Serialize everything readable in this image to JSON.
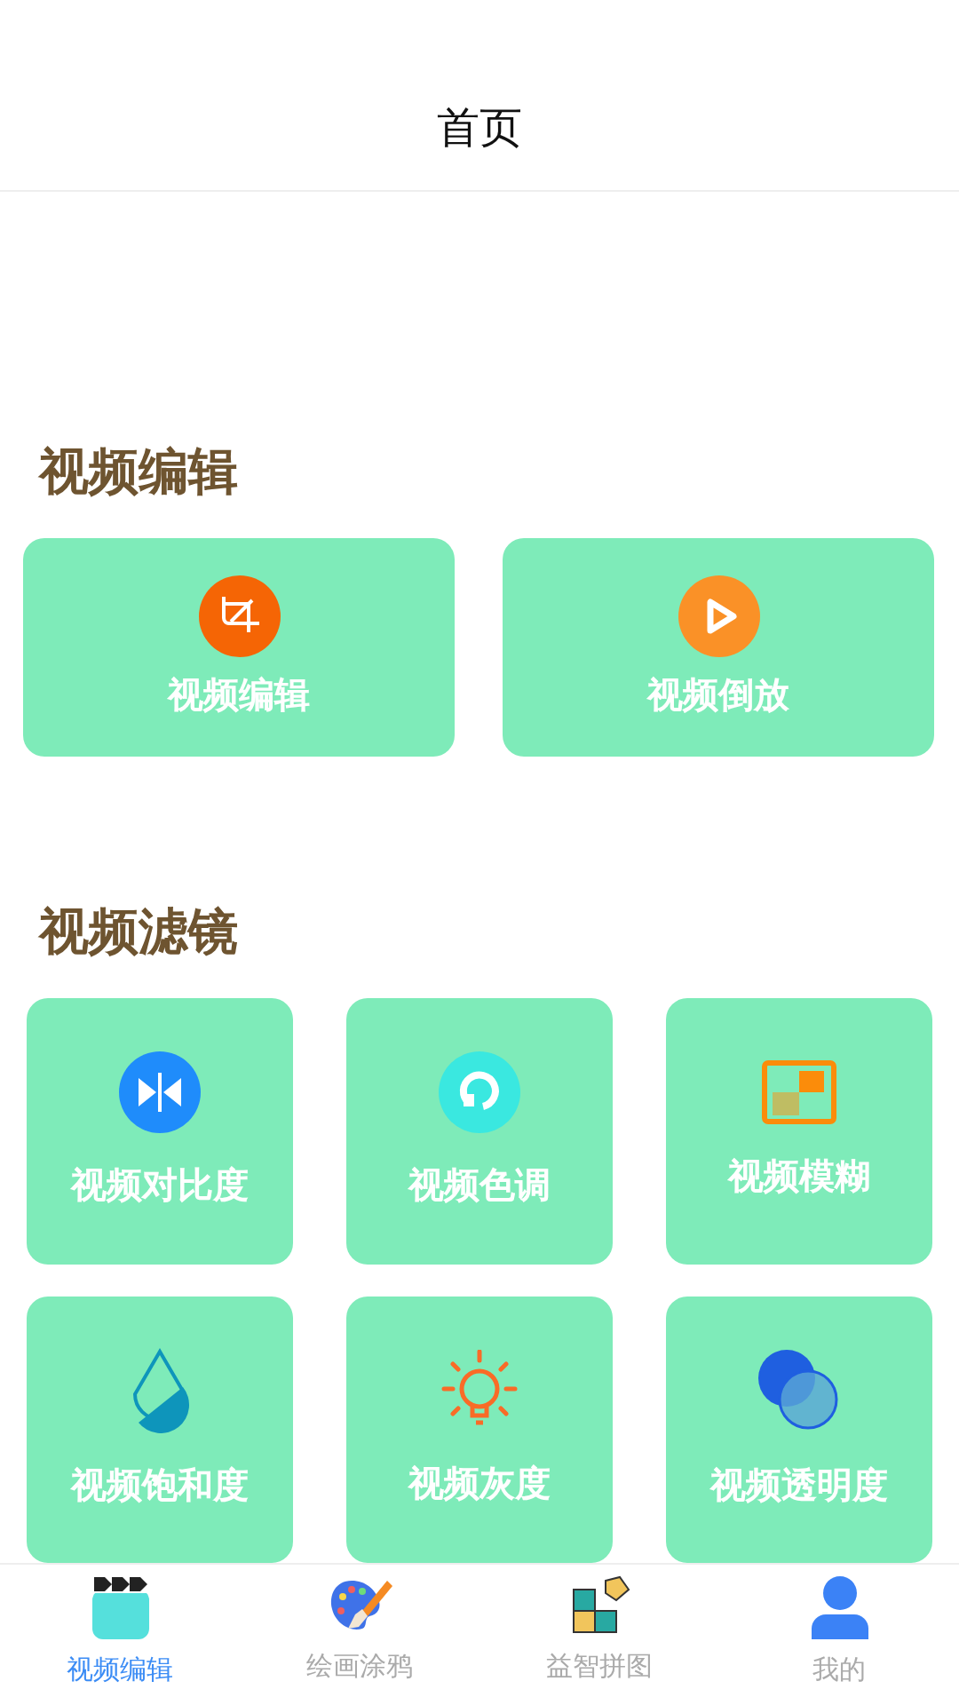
{
  "header": {
    "title": "首页"
  },
  "sections": [
    {
      "title": "视频编辑",
      "kind": "wide",
      "items": [
        {
          "label": "视频编辑"
        },
        {
          "label": "视频倒放"
        }
      ]
    },
    {
      "title": "视频滤镜",
      "kind": "grid",
      "items": [
        {
          "label": "视频对比度"
        },
        {
          "label": "视频色调"
        },
        {
          "label": "视频模糊"
        },
        {
          "label": "视频饱和度"
        },
        {
          "label": "视频灰度"
        },
        {
          "label": "视频透明度"
        }
      ]
    }
  ],
  "tab_bar": [
    {
      "label": "视频编辑",
      "selected": true
    },
    {
      "label": "绘画涂鸦",
      "selected": false
    },
    {
      "label": "益智拼图",
      "selected": false
    },
    {
      "label": "我的",
      "selected": false
    }
  ]
}
